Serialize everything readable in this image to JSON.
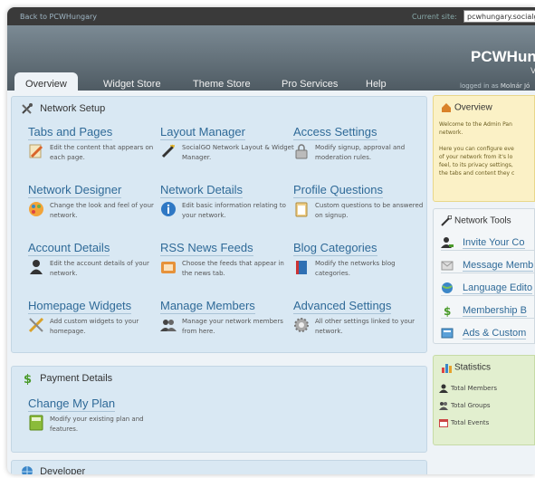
{
  "topbar": {
    "back_label": "Back to PCWHungary",
    "current_site_label": "Current site:",
    "current_site_value": "pcwhungary.socialgo"
  },
  "header": {
    "brand": "PCWHun",
    "brand_sub": "V",
    "logged_in_prefix": "logged in as",
    "logged_in_user": "Molnár Jó"
  },
  "tabs": [
    {
      "label": "Overview"
    },
    {
      "label": "Widget Store"
    },
    {
      "label": "Theme Store"
    },
    {
      "label": "Pro Services"
    },
    {
      "label": "Help"
    }
  ],
  "network_setup": {
    "title": "Network Setup",
    "items": [
      {
        "title": "Tabs and Pages",
        "desc": "Edit the content that appears on each page.",
        "icon": "pencil-page-icon"
      },
      {
        "title": "Layout Manager",
        "desc": "SocialGO Network Layout & Widget Manager.",
        "icon": "wand-icon"
      },
      {
        "title": "Access Settings",
        "desc": "Modify signup, approval and moderation rules.",
        "icon": "lock-icon"
      },
      {
        "title": "Network Designer",
        "desc": "Change the look and feel of your network.",
        "icon": "palette-icon"
      },
      {
        "title": "Network Details",
        "desc": "Edit basic information relating to your network.",
        "icon": "info-icon"
      },
      {
        "title": "Profile Questions",
        "desc": "Custom questions to be answered on signup.",
        "icon": "clipboard-icon"
      },
      {
        "title": "Account Details",
        "desc": "Edit the account details of your network.",
        "icon": "user-icon"
      },
      {
        "title": "RSS News Feeds",
        "desc": "Choose the feeds that appear in the news tab.",
        "icon": "rss-icon"
      },
      {
        "title": "Blog Categories",
        "desc": "Modify the networks blog categories.",
        "icon": "book-icon"
      },
      {
        "title": "Homepage Widgets",
        "desc": "Add custom widgets to your homepage.",
        "icon": "tools-icon"
      },
      {
        "title": "Manage Members",
        "desc": "Manage your network members from here.",
        "icon": "members-icon"
      },
      {
        "title": "Advanced Settings",
        "desc": "All other settings linked to your network.",
        "icon": "gear-icon"
      }
    ]
  },
  "payment": {
    "title": "Payment Details",
    "item": {
      "title": "Change My Plan",
      "desc": "Modify your existing plan and features.",
      "icon": "calculator-icon"
    }
  },
  "developer": {
    "title": "Developer"
  },
  "overview_panel": {
    "title": "Overview",
    "lines": [
      "Welcome to the Admin Pan",
      "network.",
      "",
      "Here you can configure eve",
      "of your network from it's lo",
      "feel, to its privacy settings,",
      "the tabs and content they c"
    ]
  },
  "network_tools": {
    "title": "Network Tools",
    "items": [
      {
        "label": "Invite Your Co",
        "icon": "invite-user-icon"
      },
      {
        "label": "Message Memb",
        "icon": "envelope-icon"
      },
      {
        "label": "Language Edito",
        "icon": "globe-icon"
      },
      {
        "label": "Membership B",
        "icon": "dollar-icon"
      },
      {
        "label": "Ads & Custom",
        "icon": "ad-icon"
      }
    ]
  },
  "statistics": {
    "title": "Statistics",
    "items": [
      {
        "label": "Total Members",
        "icon": "member-icon"
      },
      {
        "label": "Total Groups",
        "icon": "group-icon"
      },
      {
        "label": "Total Events",
        "icon": "calendar-icon"
      }
    ]
  },
  "colors": {
    "accent_link": "#2f6a98",
    "panel_blue": "#d9e8f3",
    "overview_yellow": "#fbf1c6",
    "stats_green": "#e2efcf"
  }
}
